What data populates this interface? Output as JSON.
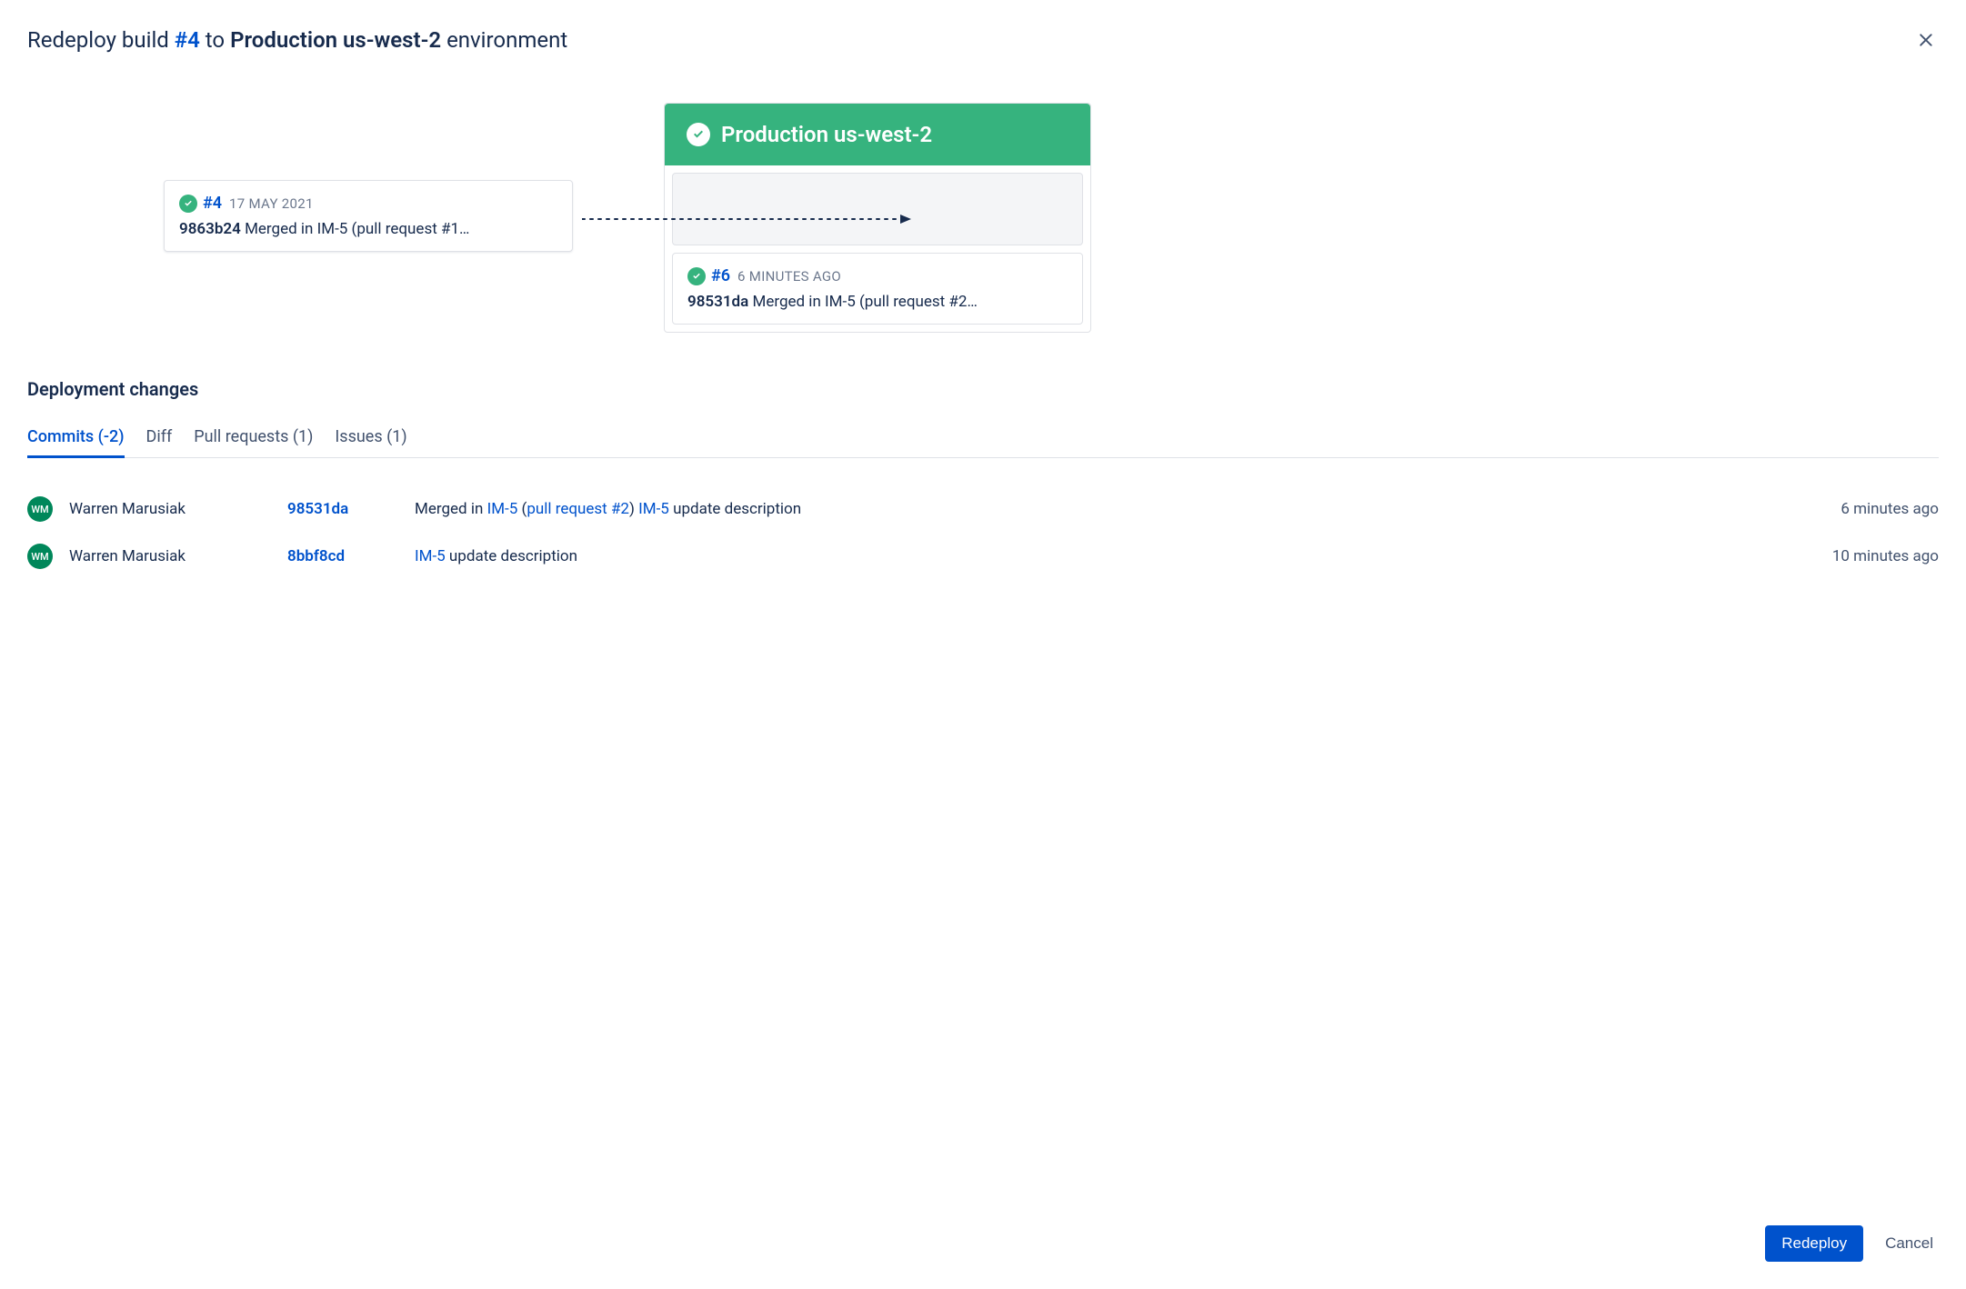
{
  "header": {
    "title_prefix": "Redeploy build ",
    "build_link": "#4",
    "title_mid": " to ",
    "environment": "Production us-west-2",
    "title_suffix": " environment"
  },
  "source_build": {
    "build": "#4",
    "date": "17 MAY 2021",
    "hash": "9863b24",
    "message": "Merged in IM-5 (pull request #1…"
  },
  "target_env": {
    "name": "Production us-west-2"
  },
  "current_build": {
    "build": "#6",
    "date": "6 MINUTES AGO",
    "hash": "98531da",
    "message": "Merged in IM-5 (pull request #2…"
  },
  "section_title": "Deployment changes",
  "tabs": {
    "commits": "Commits (-2)",
    "diff": "Diff",
    "pull_requests": "Pull requests (1)",
    "issues": "Issues (1)"
  },
  "commits": [
    {
      "avatar": "WM",
      "author": "Warren Marusiak",
      "hash": "98531da",
      "msg_prefix": "Merged in ",
      "issue1": "IM-5",
      "msg_paren_open": " (",
      "pr": "pull request #2",
      "msg_paren_close": ") ",
      "issue2": "IM-5",
      "msg_suffix": " update description",
      "time": "6 minutes ago"
    },
    {
      "avatar": "WM",
      "author": "Warren Marusiak",
      "hash": "8bbf8cd",
      "msg_prefix": "",
      "issue1": "IM-5",
      "msg_paren_open": "",
      "pr": "",
      "msg_paren_close": "",
      "issue2": "",
      "msg_suffix": " update description",
      "time": "10 minutes ago"
    }
  ],
  "footer": {
    "primary": "Redeploy",
    "secondary": "Cancel"
  }
}
